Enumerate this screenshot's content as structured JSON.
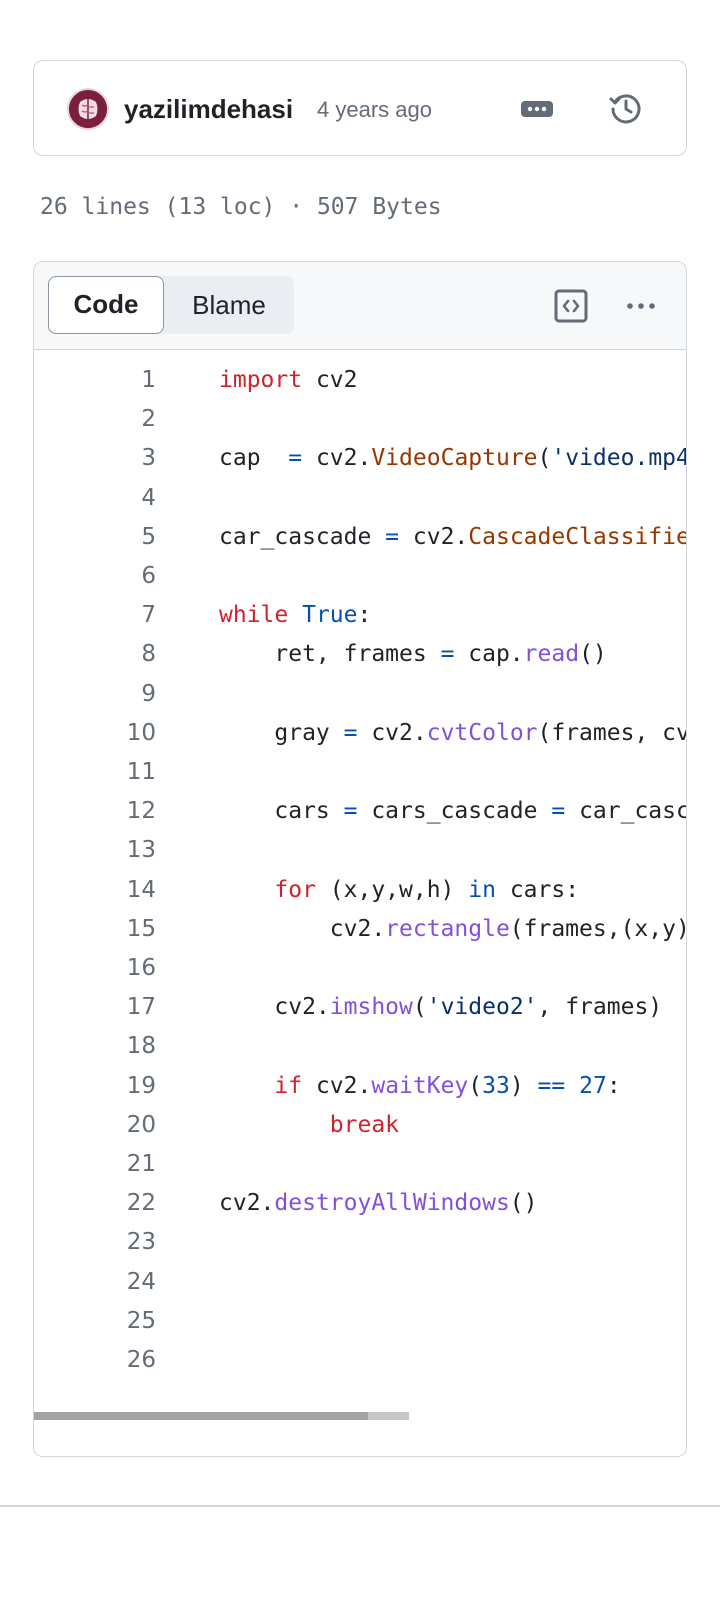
{
  "commit": {
    "author": "yazilimdehasi",
    "time": "4 years ago",
    "more_icon": "kebab-horizontal-icon",
    "history_icon": "history-icon"
  },
  "file_meta": "26 lines (13 loc) · 507 Bytes",
  "code_header": {
    "tabs": [
      "Code",
      "Blame"
    ],
    "active_tab": "Code",
    "symbols_icon": "code-square-icon",
    "more_icon": "kebab-horizontal-icon"
  },
  "colors": {
    "keyword": "#cf222e",
    "class": "#953800",
    "function": "#8250df",
    "constant": "#0550ae",
    "string": "#0a3069",
    "text": "#1f2328",
    "line_number": "#636c76"
  },
  "code_lines": [
    {
      "n": "1",
      "tokens": [
        [
          "import",
          "k"
        ],
        [
          " cv2",
          "t"
        ]
      ]
    },
    {
      "n": "2",
      "tokens": []
    },
    {
      "n": "3",
      "tokens": [
        [
          "cap  ",
          "t"
        ],
        [
          "=",
          "c"
        ],
        [
          " cv2.",
          "t"
        ],
        [
          "VideoCapture",
          "cl"
        ],
        [
          "(",
          "t"
        ],
        [
          "'video.mp4",
          "s"
        ]
      ]
    },
    {
      "n": "4",
      "tokens": []
    },
    {
      "n": "5",
      "tokens": [
        [
          "car_cascade ",
          "t"
        ],
        [
          "=",
          "c"
        ],
        [
          " cv2.",
          "t"
        ],
        [
          "CascadeClassifier",
          "cl"
        ]
      ]
    },
    {
      "n": "6",
      "tokens": []
    },
    {
      "n": "7",
      "tokens": [
        [
          "while",
          "k"
        ],
        [
          " ",
          "t"
        ],
        [
          "True",
          "c"
        ],
        [
          ":",
          "t"
        ]
      ]
    },
    {
      "n": "8",
      "tokens": [
        [
          "    ret, frames ",
          "t"
        ],
        [
          "=",
          "c"
        ],
        [
          " cap.",
          "t"
        ],
        [
          "read",
          "f"
        ],
        [
          "()",
          "t"
        ]
      ]
    },
    {
      "n": "9",
      "tokens": []
    },
    {
      "n": "10",
      "tokens": [
        [
          "    gray ",
          "t"
        ],
        [
          "=",
          "c"
        ],
        [
          " cv2.",
          "t"
        ],
        [
          "cvtColor",
          "f"
        ],
        [
          "(frames, cv",
          "t"
        ]
      ]
    },
    {
      "n": "11",
      "tokens": []
    },
    {
      "n": "12",
      "tokens": [
        [
          "    cars ",
          "t"
        ],
        [
          "=",
          "c"
        ],
        [
          " cars_cascade ",
          "t"
        ],
        [
          "=",
          "c"
        ],
        [
          " car_casca",
          "t"
        ]
      ]
    },
    {
      "n": "13",
      "tokens": []
    },
    {
      "n": "14",
      "tokens": [
        [
          "    ",
          "t"
        ],
        [
          "for",
          "k"
        ],
        [
          " (x,y,w,h) ",
          "t"
        ],
        [
          "in",
          "c"
        ],
        [
          " cars:",
          "t"
        ]
      ]
    },
    {
      "n": "15",
      "tokens": [
        [
          "        cv2.",
          "t"
        ],
        [
          "rectangle",
          "f"
        ],
        [
          "(frames,(x,y)",
          "t"
        ]
      ]
    },
    {
      "n": "16",
      "tokens": []
    },
    {
      "n": "17",
      "tokens": [
        [
          "    cv2.",
          "t"
        ],
        [
          "imshow",
          "f"
        ],
        [
          "(",
          "t"
        ],
        [
          "'video2'",
          "s"
        ],
        [
          ", frames)",
          "t"
        ]
      ]
    },
    {
      "n": "18",
      "tokens": []
    },
    {
      "n": "19",
      "tokens": [
        [
          "    ",
          "t"
        ],
        [
          "if",
          "k"
        ],
        [
          " cv2.",
          "t"
        ],
        [
          "waitKey",
          "f"
        ],
        [
          "(",
          "t"
        ],
        [
          "33",
          "c"
        ],
        [
          ") ",
          "t"
        ],
        [
          "==",
          "c"
        ],
        [
          " ",
          "t"
        ],
        [
          "27",
          "c"
        ],
        [
          ":",
          "t"
        ]
      ]
    },
    {
      "n": "20",
      "tokens": [
        [
          "        ",
          "t"
        ],
        [
          "break",
          "k"
        ]
      ]
    },
    {
      "n": "21",
      "tokens": []
    },
    {
      "n": "22",
      "tokens": [
        [
          "cv2.",
          "t"
        ],
        [
          "destroyAllWindows",
          "f"
        ],
        [
          "()",
          "t"
        ]
      ]
    },
    {
      "n": "23",
      "tokens": []
    },
    {
      "n": "24",
      "tokens": []
    },
    {
      "n": "25",
      "tokens": []
    },
    {
      "n": "26",
      "tokens": []
    }
  ],
  "horizontal_scroll_fraction": 0.89
}
